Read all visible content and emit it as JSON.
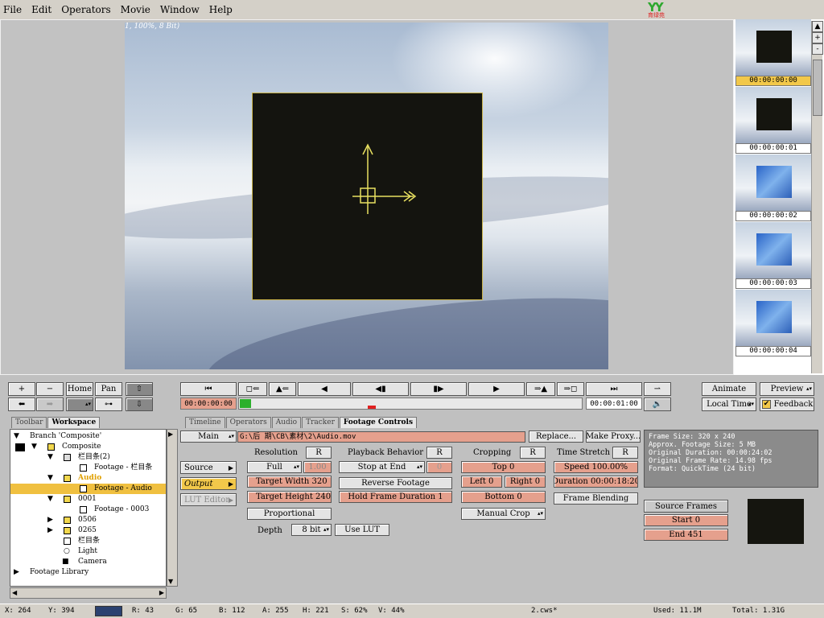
{
  "menu": [
    "File",
    "Edit",
    "Operators",
    "Movie",
    "Window",
    "Help"
  ],
  "logo_text": "YY",
  "logo_sub": "育绿苑",
  "viewer": {
    "label": "1, 100%, 8 Bit)"
  },
  "thumbs": [
    "00:00:00:00",
    "00:00:00:01",
    "00:00:00:02",
    "00:00:00:03",
    "00:00:00:04"
  ],
  "nav_buttons": {
    "home": "Home",
    "pan": "Pan"
  },
  "transport": {
    "time_current": "00:00:00:00",
    "time_end": "00:00:01:00"
  },
  "right_buttons": {
    "animate": "Animate",
    "preview": "Preview",
    "local_time": "Local Time",
    "feedback": "Feedback"
  },
  "tabs_left": [
    "Toolbar",
    "Workspace"
  ],
  "tree": [
    {
      "label": "Branch 'Composite'",
      "indent": 10
    },
    {
      "label": "Composite",
      "indent": 64
    },
    {
      "label": "栏目条(2)",
      "indent": 84
    },
    {
      "label": "Footage - 栏目条",
      "indent": 104
    },
    {
      "label": "Audio",
      "indent": 84
    },
    {
      "label": "Footage - Audio",
      "indent": 104
    },
    {
      "label": "0001",
      "indent": 84
    },
    {
      "label": "Footage - 0003",
      "indent": 104
    },
    {
      "label": "0506",
      "indent": 84
    },
    {
      "label": "0265",
      "indent": 84
    },
    {
      "label": "栏目条",
      "indent": 84
    },
    {
      "label": "Light",
      "indent": 84
    },
    {
      "label": "Camera",
      "indent": 84
    },
    {
      "label": "Footage Library",
      "indent": 24
    }
  ],
  "tabs_mid": [
    "Timeline",
    "Operators",
    "Audio",
    "Tracker",
    "Footage Controls"
  ],
  "footage": {
    "main": "Main",
    "path": "G:\\后 期\\CB\\素材\\2\\Audio.mov",
    "replace": "Replace...",
    "make_proxy": "Make Proxy...",
    "source": "Source",
    "output": "Output",
    "lut_editor": "LUT Editor",
    "resolution_label": "Resolution",
    "r": "R",
    "resolution": "Full",
    "scale": "1.00",
    "target_width": "Target Width 320",
    "target_height": "Target Height 240",
    "proportional": "Proportional",
    "depth_label": "Depth",
    "depth": "8 bit",
    "use_lut": "Use LUT",
    "playback_label": "Playback Behavior",
    "playback": "Stop at End",
    "playback_value": "0",
    "reverse": "Reverse Footage",
    "hold": "Hold Frame Duration 1",
    "cropping_label": "Cropping",
    "top": "Top 0",
    "left": "Left 0",
    "right": "Right 0",
    "bottom": "Bottom 0",
    "manual_crop": "Manual Crop",
    "time_stretch_label": "Time Stretch",
    "speed": "Speed 100.00%",
    "duration": "Duration 00:00:18:20",
    "frame_blending": "Frame Blending"
  },
  "info": [
    "Frame Size: 320 x 240",
    "Approx. Footage Size:     5 MB",
    "Original Duration: 00:00:24:02",
    "Original Frame Rate: 14.98 fps",
    "Format: QuickTime (24 bit)"
  ],
  "source_frames": {
    "label": "Source Frames",
    "start": "Start 0",
    "end": "End 451"
  },
  "status": {
    "x": "X:   264",
    "y": "Y:  394",
    "r": "R:  43",
    "g": "G:  65",
    "b": "B:  112",
    "a": "A:  255",
    "h": "H:  221",
    "s": "S:  62%",
    "v": "V:  44%",
    "file": "2.cws*",
    "used": "Used:  11.1M",
    "total": "Total:  1.31G"
  },
  "colors": {
    "swatch": "#2b4170",
    "highlight": "#f0c040",
    "pink": "#e5a08d"
  }
}
